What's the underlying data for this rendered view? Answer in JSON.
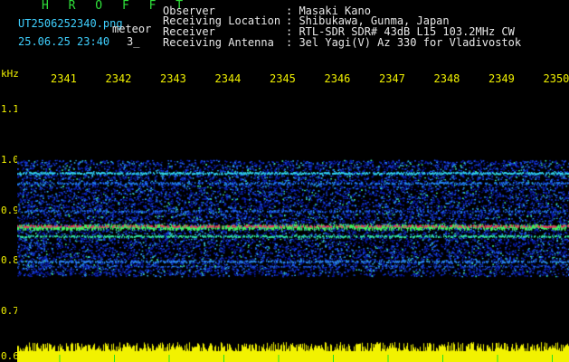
{
  "app": {
    "title": "H R O F F T"
  },
  "file": {
    "name": "UT2506252340.png",
    "caption_type": "meteor",
    "timestamp": "25.06.25 23:40",
    "count": "3_"
  },
  "header": {
    "rows": [
      {
        "key": "Observer",
        "value": ": Masaki Kano"
      },
      {
        "key": "Receiving Location",
        "value": ": Shibukawa, Gunma, Japan"
      },
      {
        "key": "Receiver",
        "value": ": RTL-SDR SDR# 43dB L15 103.2MHz CW"
      },
      {
        "key": "Receiving Antenna",
        "value": ": 3el Yagi(V) Az 330 for Vladivostok"
      }
    ]
  },
  "colors": {
    "background": "#000000",
    "title": "#2fe03a",
    "axis": "#f2f200",
    "text": "#e8e8e8",
    "filename": "#3fd0ff"
  },
  "chart_data": {
    "type": "heatmap",
    "ylabel": "kHz",
    "x_ticks": [
      "2341",
      "2342",
      "2343",
      "2344",
      "2345",
      "2346",
      "2347",
      "2348",
      "2349",
      "2350"
    ],
    "y_ticks": [
      "1.1",
      "1.0",
      "0.9",
      "0.8",
      "0.7",
      "0.6"
    ],
    "ylim": [
      0.6,
      1.15
    ],
    "signal_band": [
      0.77,
      1.0
    ],
    "strong_lines_khz": [
      0.975,
      0.87,
      0.85
    ],
    "grid": false,
    "legend": "none"
  }
}
